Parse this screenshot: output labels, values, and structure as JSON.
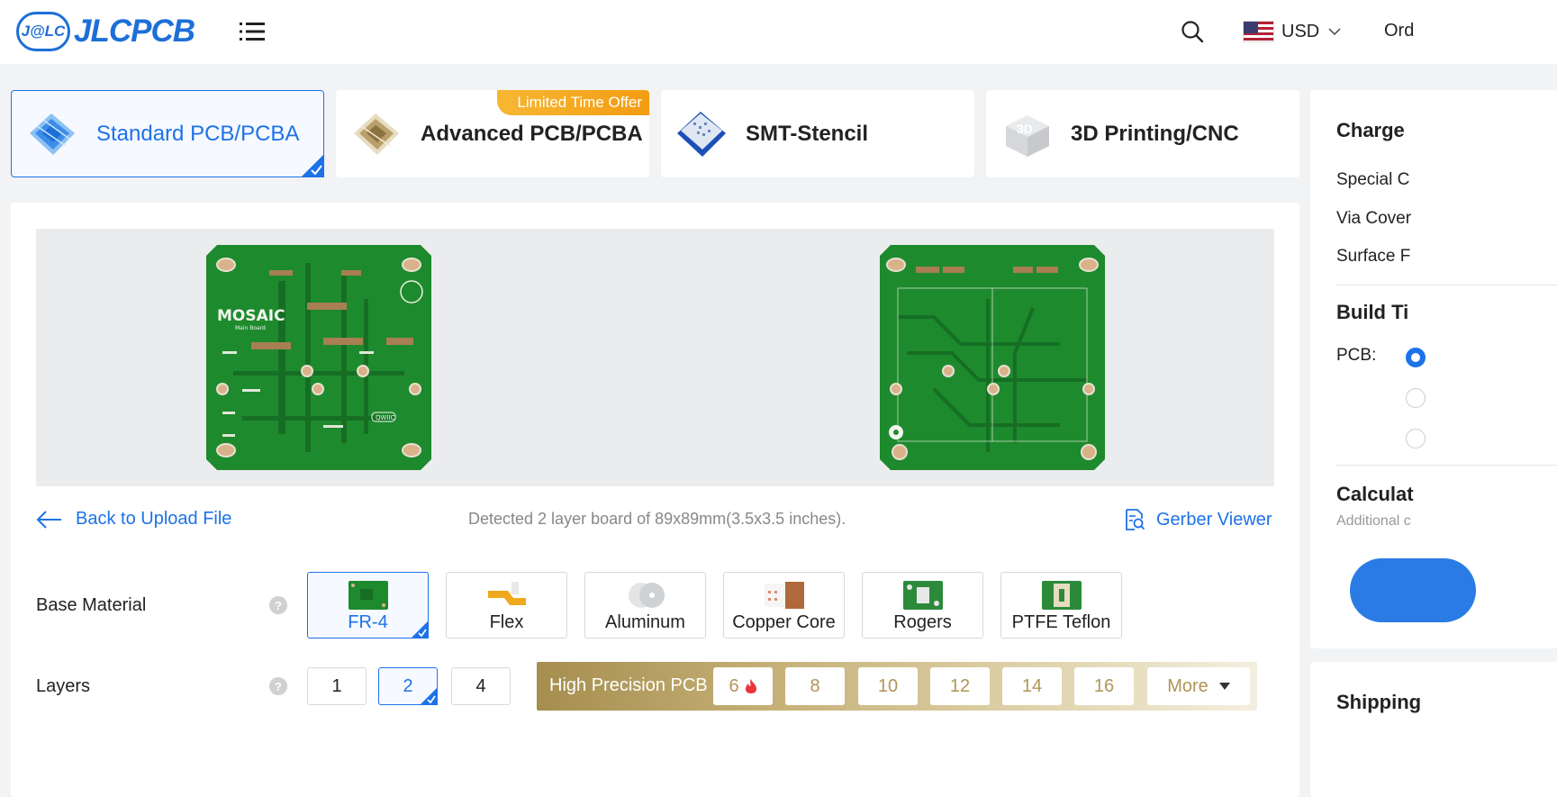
{
  "header": {
    "logo_badge": "J@LC",
    "logo_text": "JLCPCB",
    "currency": "USD",
    "orders_label": "Ord"
  },
  "product_tabs": [
    {
      "label": "Standard PCB/PCBA",
      "active": true
    },
    {
      "label": "Advanced PCB/PCBA",
      "badge": "Limited Time Offer"
    },
    {
      "label": "SMT-Stencil"
    },
    {
      "label": "3D Printing/CNC"
    }
  ],
  "upload": {
    "back_label": "Back to Upload File",
    "detected_text": "Detected 2 layer board of 89x89mm(3.5x3.5 inches).",
    "gerber_label": "Gerber Viewer"
  },
  "board_preview": {
    "top_logo_text": "MOSAIC",
    "top_logo_sub": "Main Board",
    "top_tag": "QWIIC"
  },
  "base_material": {
    "label": "Base Material",
    "help": "?",
    "options": [
      "FR-4",
      "Flex",
      "Aluminum",
      "Copper Core",
      "Rogers",
      "PTFE Teflon"
    ],
    "selected": "FR-4"
  },
  "layers": {
    "label": "Layers",
    "help": "?",
    "options": [
      "1",
      "2",
      "4"
    ],
    "selected": "2",
    "high_precision": {
      "label": "High Precision PCB",
      "options": [
        "6",
        "8",
        "10",
        "12",
        "14",
        "16"
      ],
      "more_label": "More"
    }
  },
  "right_panel": {
    "charge_title": "Charge",
    "charge_items": [
      "Special C",
      "Via Cover",
      "Surface F"
    ],
    "build_time_title": "Build Ti",
    "pcb_label": "PCB:",
    "calculate_title": "Calculat",
    "calculate_sub": "Additional c",
    "shipping_title": "Shipping"
  },
  "colors": {
    "accent": "#1d72e8",
    "pcb_green": "#1e8a2e",
    "gold": "#b09557"
  }
}
